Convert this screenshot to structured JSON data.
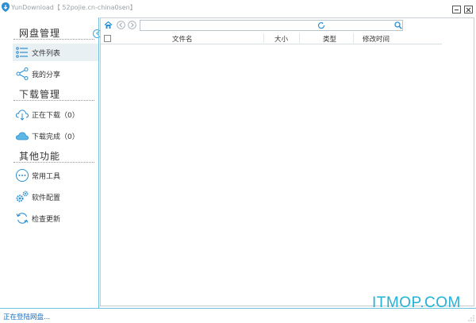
{
  "window": {
    "title": "YunDownload【 52pojie.cn-china0sen】",
    "min_icon": "minimize-icon",
    "close_icon": "close-icon"
  },
  "sidebar": {
    "sections": [
      {
        "title": "网盘管理",
        "items": [
          {
            "label": "文件列表",
            "icon": "list-icon",
            "active": true
          },
          {
            "label": "我的分享",
            "icon": "share-icon"
          }
        ]
      },
      {
        "title": "下载管理",
        "items": [
          {
            "label": "正在下载（0）",
            "icon": "cloud-download-icon"
          },
          {
            "label": "下载完成（0）",
            "icon": "cloud-done-icon"
          }
        ]
      },
      {
        "title": "其他功能",
        "items": [
          {
            "label": "常用工具",
            "icon": "more-icon"
          },
          {
            "label": "软件配置",
            "icon": "gear-icon"
          },
          {
            "label": "检查更新",
            "icon": "refresh-icon"
          }
        ]
      }
    ]
  },
  "toolbar": {
    "icons": [
      "home-icon",
      "back-icon",
      "forward-icon"
    ],
    "path_value": "",
    "refresh_icon": "refresh-icon",
    "search_icon": "search-icon"
  },
  "file_list": {
    "columns": [
      "文件名",
      "大小",
      "类型",
      "修改时间"
    ],
    "rows": []
  },
  "status": {
    "text": "正在登陆网盘..."
  },
  "watermark": "ITMOP.COM",
  "colors": {
    "accent": "#4aa3d8",
    "status_text": "#1a6fc2",
    "watermark": "#22b2d8",
    "divider": "#6fc3df"
  }
}
